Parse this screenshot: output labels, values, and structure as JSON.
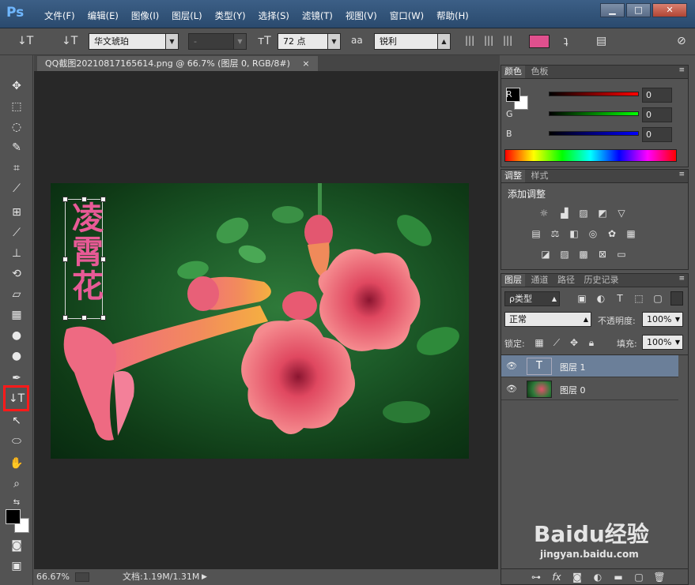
{
  "app": {
    "logo": "Ps"
  },
  "menu": [
    "文件(F)",
    "编辑(E)",
    "图像(I)",
    "图层(L)",
    "类型(Y)",
    "选择(S)",
    "滤镜(T)",
    "视图(V)",
    "窗口(W)",
    "帮助(H)"
  ],
  "window_buttons": {
    "minimize": "▁",
    "maximize": "□",
    "close": "✕"
  },
  "options": {
    "tool_icon": "↓T",
    "orient_icon": "↓T",
    "font_family": "华文琥珀",
    "font_style": "-",
    "size_icon": "тT",
    "font_size": "72 点",
    "aa_icon": "aa",
    "antialias": "锐利",
    "text_color": "#e0508e"
  },
  "document": {
    "tab_title": "QQ截图20210817165614.png @ 66.7% (图层 0, RGB/8#)",
    "tab_close": "×",
    "text_layer_content": "凌霄花",
    "text_color": "#e85a96"
  },
  "status": {
    "zoom": "66.67%",
    "doc_info": "文档:1.19M/1.31M"
  },
  "color_panel": {
    "tabs": [
      "颜色",
      "色板"
    ],
    "channels": [
      {
        "label": "R",
        "value": "0"
      },
      {
        "label": "G",
        "value": "0"
      },
      {
        "label": "B",
        "value": "0"
      }
    ],
    "fg": "#000000",
    "bg": "#ffffff"
  },
  "adjust_panel": {
    "tabs": [
      "调整",
      "样式"
    ],
    "heading": "添加调整"
  },
  "layers_panel": {
    "tabs": [
      "图层",
      "通道",
      "路径",
      "历史记录"
    ],
    "filter": "ρ类型",
    "blend_mode": "正常",
    "opacity_label": "不透明度:",
    "opacity": "100%",
    "lock_label": "锁定:",
    "fill_label": "填充:",
    "fill": "100%",
    "layers": [
      {
        "name": "图层 1",
        "type": "text",
        "thumb": "T",
        "selected": true
      },
      {
        "name": "图层 0",
        "type": "image",
        "selected": false
      }
    ],
    "footer_icons": [
      "link-icon",
      "fx-icon",
      "mask-icon",
      "adjustment-icon",
      "folder-icon",
      "new-layer-icon",
      "trash-icon"
    ]
  },
  "watermark": {
    "text": "Baidu经验",
    "sub": "jingyan.baidu.com"
  }
}
